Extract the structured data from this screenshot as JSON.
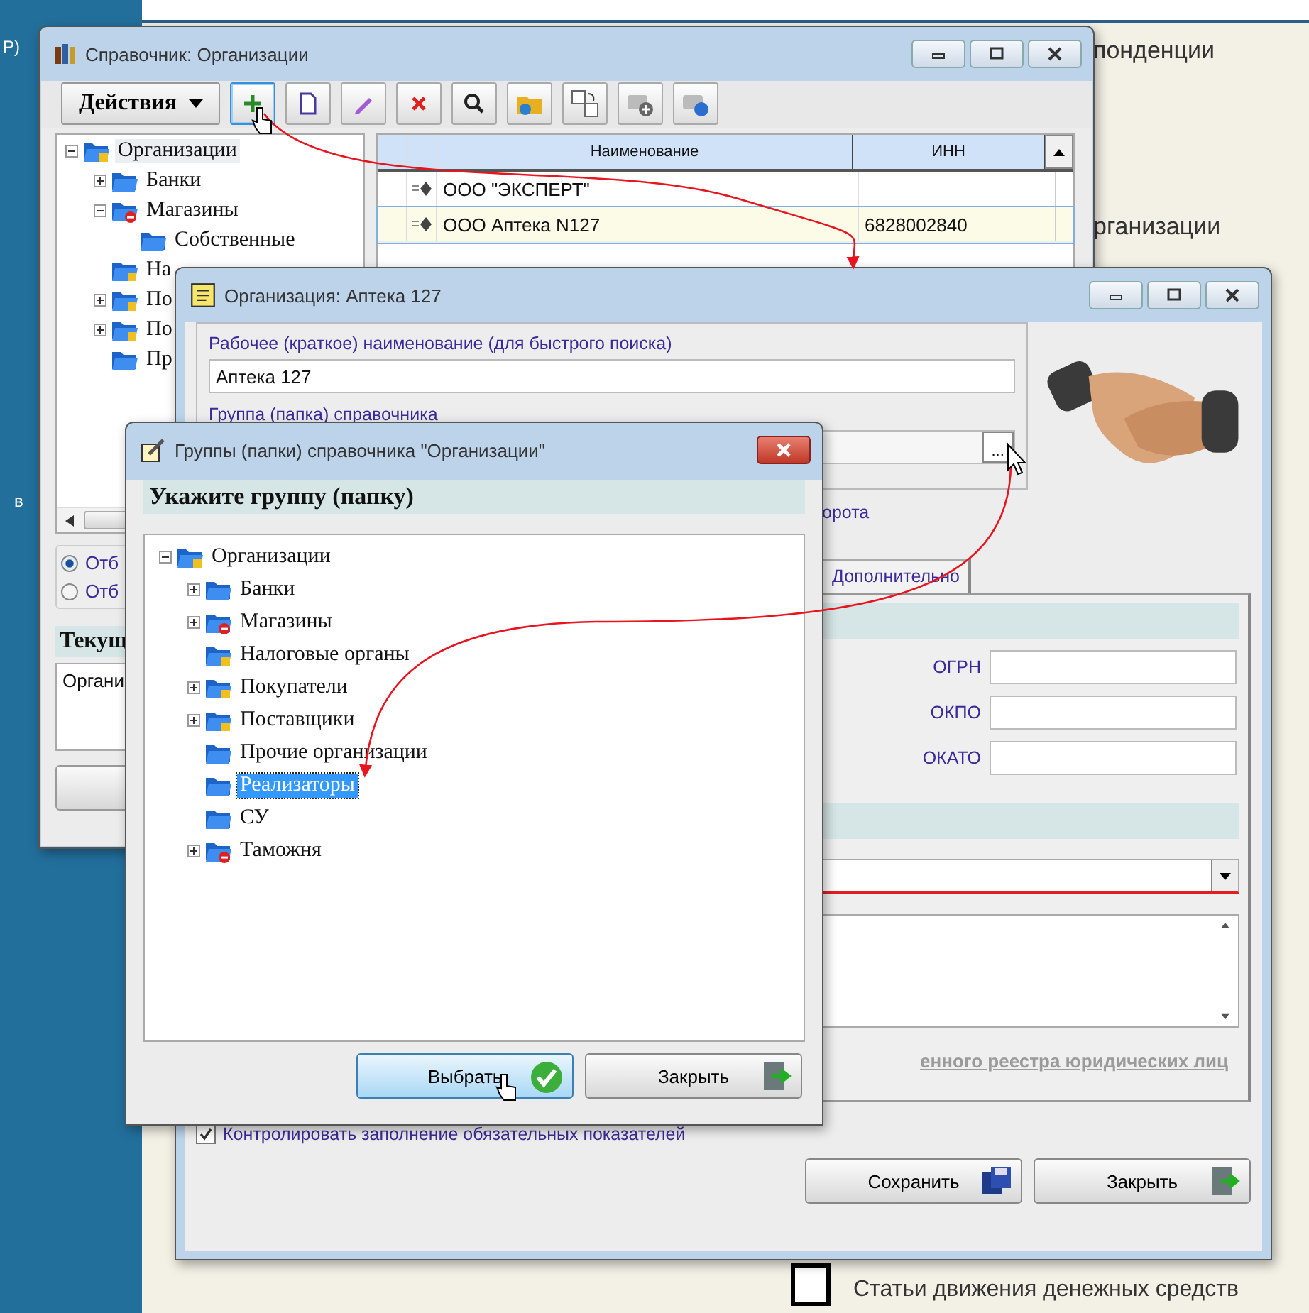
{
  "desktop": {
    "left_texts": [
      "Р)",
      "в"
    ],
    "right_texts": [
      "понденции",
      "рганизации"
    ],
    "footer_item": {
      "label": "Статьи движения денежных средств",
      "checked": false
    }
  },
  "catalog": {
    "title": "Справочник: Организации",
    "actions_button": "Действия",
    "tree": [
      {
        "label": "Организации",
        "kind": "lock",
        "expanded": true,
        "selected": true,
        "children": [
          {
            "label": "Банки",
            "kind": "plain",
            "expanded": false,
            "selected": false
          },
          {
            "label": "Магазины",
            "kind": "stop",
            "expanded": true,
            "selected": false,
            "children": [
              {
                "label": "Собственные",
                "kind": "plain",
                "selected": false
              }
            ]
          },
          {
            "label": "На",
            "kind": "lock",
            "selected": false
          },
          {
            "label": "По",
            "kind": "lock",
            "expanded": false,
            "selected": false
          },
          {
            "label": "По",
            "kind": "lock",
            "expanded": false,
            "selected": false
          },
          {
            "label": "Пр",
            "kind": "plain",
            "selected": false
          }
        ]
      }
    ],
    "radios": [
      {
        "label": "Отб",
        "selected": true
      },
      {
        "label": "Отб",
        "selected": false
      }
    ],
    "current_label": "Текущ",
    "current_value": "Органи",
    "columns": [
      "Наименование",
      "ИНН"
    ],
    "rows": [
      {
        "cells": [
          "ООО \"ЭКСПЕРТ\""
        ],
        "selected": false
      },
      {
        "cells": [
          "ООО Аптека N127",
          "6828002840"
        ],
        "selected": true
      }
    ]
  },
  "organization": {
    "title": "Организация: Аптека 127",
    "short_name_label": "Рабочее (краткое) наименование (для быстрого поиска)",
    "short_name": "Аптека 127",
    "group_label": "Группа (папка) справочника",
    "group_button": "...",
    "partial_label": "орота",
    "tabs": [
      {
        "label": "Дополнительно",
        "selected": true
      }
    ],
    "codes": [
      {
        "label": "ОГРН"
      },
      {
        "label": "ОКПО"
      },
      {
        "label": "ОКАТО"
      }
    ],
    "register_link": "енного реестра юридических лиц",
    "control_checkbox": {
      "label": "Контролировать заполнение обязательных показателей",
      "checked": true
    },
    "buttons": [
      {
        "label": "Сохранить",
        "kind": "save"
      },
      {
        "label": "Закрыть",
        "kind": "close"
      }
    ]
  },
  "groups": {
    "title": "Группы (папки) справочника \"Организации\"",
    "prompt": "Укажите группу (папку)",
    "tree": [
      {
        "label": "Организации",
        "kind": "lock",
        "expanded": true,
        "selected": false,
        "children": [
          {
            "label": "Банки",
            "kind": "plain",
            "expanded": false,
            "selected": false
          },
          {
            "label": "Магазины",
            "kind": "stop",
            "expanded": false,
            "selected": false
          },
          {
            "label": "Налоговые органы",
            "kind": "lock",
            "selected": false
          },
          {
            "label": "Покупатели",
            "kind": "lock",
            "expanded": false,
            "selected": false
          },
          {
            "label": "Поставщики",
            "kind": "lock",
            "expanded": false,
            "selected": false
          },
          {
            "label": "Прочие организации",
            "kind": "plain",
            "selected": false
          },
          {
            "label": "Реализаторы",
            "kind": "plain",
            "selected": true
          },
          {
            "label": "СУ",
            "kind": "plain",
            "selected": false
          },
          {
            "label": "Таможня",
            "kind": "stop",
            "expanded": false,
            "selected": false
          }
        ]
      }
    ],
    "buttons": [
      {
        "label": "Выбрать",
        "kind": "select",
        "focused": true
      },
      {
        "label": "Закрыть",
        "kind": "close",
        "focused": false
      }
    ]
  }
}
